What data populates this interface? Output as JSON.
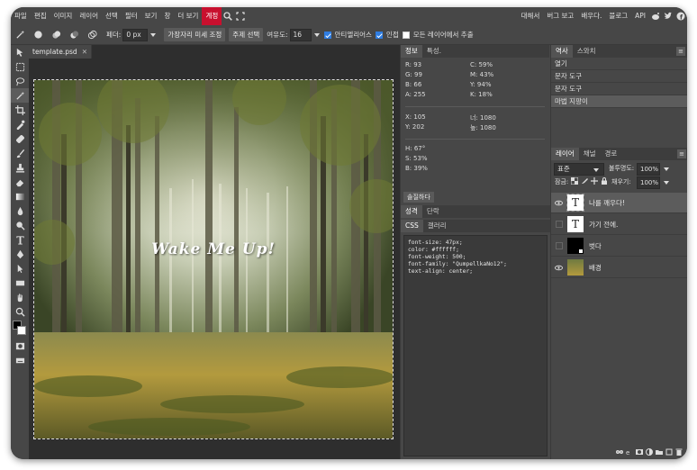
{
  "menu": {
    "items": [
      "파일",
      "편집",
      "이미지",
      "레이어",
      "선택",
      "필터",
      "보기",
      "창",
      "더 보기",
      "계정"
    ],
    "right": [
      "대해서",
      "버그 보고",
      "배우다.",
      "블로그",
      "API"
    ]
  },
  "options": {
    "feather_label": "페더:",
    "feather_value": "0 px",
    "refine_edge": "가장자리 미세 조정",
    "subject_select": "주제 선택",
    "tolerance_label": "여유도:",
    "tolerance_value": "16",
    "antialias": "안티엘리어스",
    "contiguous": "인접",
    "sample_all": "모든 레이어에서 추출"
  },
  "document": {
    "tab_name": "template.psd",
    "canvas_text": "Wake Me Up!"
  },
  "info_panel": {
    "tabs": [
      "정보",
      "특성."
    ],
    "r": "R: 93",
    "g": "G: 99",
    "b": "B: 66",
    "a": "A: 255",
    "c": "C: 59%",
    "m": "M: 43%",
    "y": "Y: 94%",
    "k": "K: 18%",
    "x": "X: 105",
    "yy": "Y: 202",
    "w": "너: 1080",
    "h": "높: 1080",
    "hh": "H: 67°",
    "s": "S: 53%",
    "bb": "B: 39%"
  },
  "char_panel": {
    "button": "솔질하다",
    "tabs": [
      "성격",
      "단락"
    ],
    "sub_tabs": [
      "CSS",
      "갤러리"
    ],
    "css_text": "font-size: 47px;\ncolor: #ffffff;\nfont-weight: 500;\nfont-family: \"QumpellkaNo12\";\ntext-align: center;"
  },
  "history_panel": {
    "tabs": [
      "역사",
      "스와치"
    ],
    "items": [
      "열기",
      "문자 도구",
      "문자 도구",
      "마법 지팡이"
    ]
  },
  "layers_panel": {
    "tabs": [
      "레이어",
      "채널",
      "경로"
    ],
    "blend_mode": "표준",
    "opacity_label": "불투명도:",
    "opacity_value": "100%",
    "lock_label": "잠금:",
    "fill_label": "채우기:",
    "fill_value": "100%",
    "layers": [
      "나를 깨우다!",
      "가기 전에.",
      "벗다",
      "배경"
    ]
  },
  "colors": {
    "accent": "#c8102e",
    "panel_bg": "#474747",
    "canvas_bg": "#2e2e2e"
  }
}
